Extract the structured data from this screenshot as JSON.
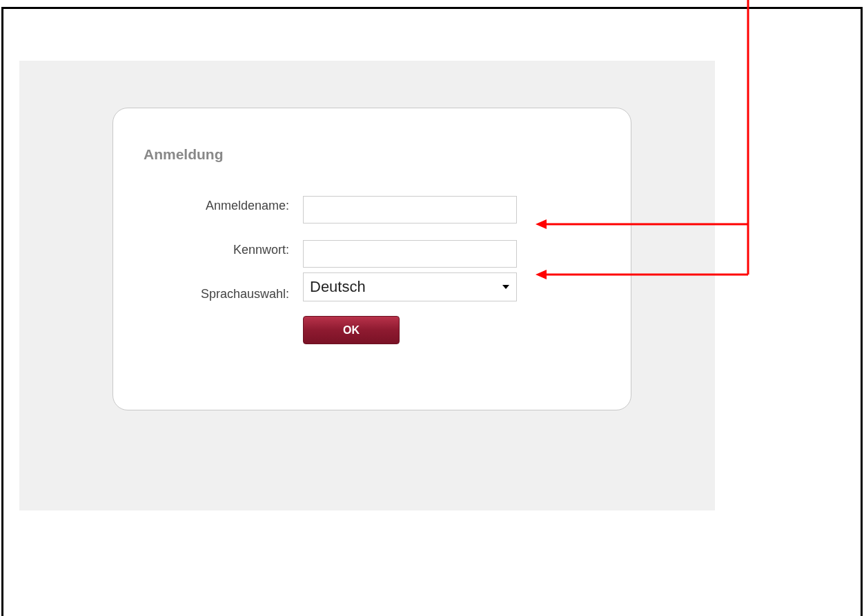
{
  "login": {
    "title": "Anmeldung",
    "fields": [
      {
        "kind": "text",
        "label": "Anmeldename:"
      },
      {
        "kind": "password",
        "label": "Kennwort:"
      },
      {
        "kind": "select",
        "label": "Sprachauswahl:",
        "value": "Deutsch"
      }
    ],
    "button": "OK"
  }
}
